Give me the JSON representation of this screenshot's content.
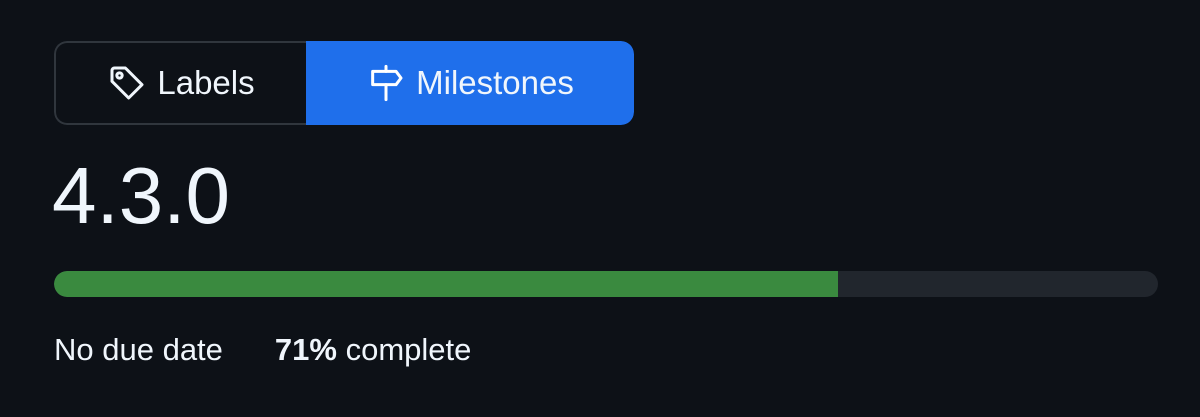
{
  "tabs": {
    "labels": {
      "label": "Labels",
      "icon": "tag-icon"
    },
    "milestones": {
      "label": "Milestones",
      "icon": "milestone-signpost-icon",
      "selected": true
    }
  },
  "milestone": {
    "title": "4.3.0",
    "due_date_text": "No due date",
    "percent_text": "71%",
    "complete_text": "complete",
    "progress_fraction": 0.71
  },
  "colors": {
    "background": "#0d1117",
    "accent_blue": "#1f6feb",
    "progress_green": "#3a8a3f",
    "progress_track": "#21262d",
    "border": "#30363d"
  }
}
